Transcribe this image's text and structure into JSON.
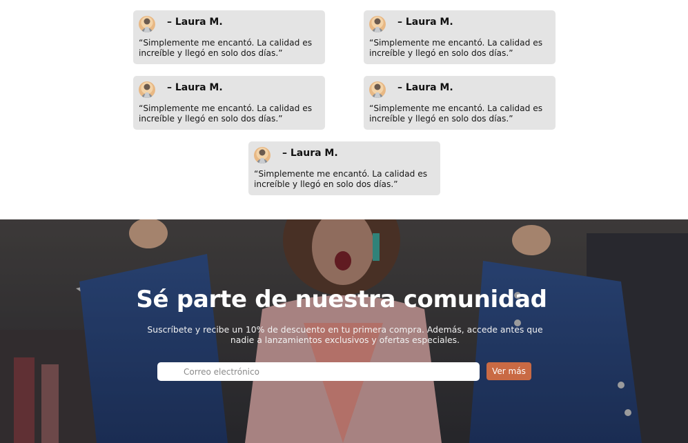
{
  "testimonials": [
    {
      "author": "– Laura M.",
      "quote": "“Simplemente me encantó. La calidad es increíble y llegó en solo dos días.”",
      "avatar_icon": "user-avatar"
    },
    {
      "author": "– Laura M.",
      "quote": "“Simplemente me encantó. La calidad es increíble y llegó en solo dos días.”",
      "avatar_icon": "user-avatar"
    },
    {
      "author": "– Laura M.",
      "quote": "“Simplemente me encantó. La calidad es increíble y llegó en solo dos días.”",
      "avatar_icon": "user-avatar"
    },
    {
      "author": "– Laura M.",
      "quote": "“Simplemente me encantó. La calidad es increíble y llegó en solo dos días.”",
      "avatar_icon": "user-avatar"
    },
    {
      "author": "– Laura M.",
      "quote": "“Simplemente me encantó. La calidad es increíble y llegó en solo dos días.”",
      "avatar_icon": "user-avatar"
    }
  ],
  "community": {
    "title": "Sé parte de nuestra comunidad",
    "subtitle": "Suscríbete y recibe un 10% de descuento en tu primera compra. Además, accede antes que nadie a lanzamientos exclusivos y ofertas especiales.",
    "email_placeholder": "Correo electrónico",
    "button_label": "Ver más",
    "background": "woman-shopping-clothes-photo"
  },
  "colors": {
    "card_bg": "#e4e4e4",
    "button_bg": "#c96a44",
    "section_bg": "#3a3a3e"
  }
}
